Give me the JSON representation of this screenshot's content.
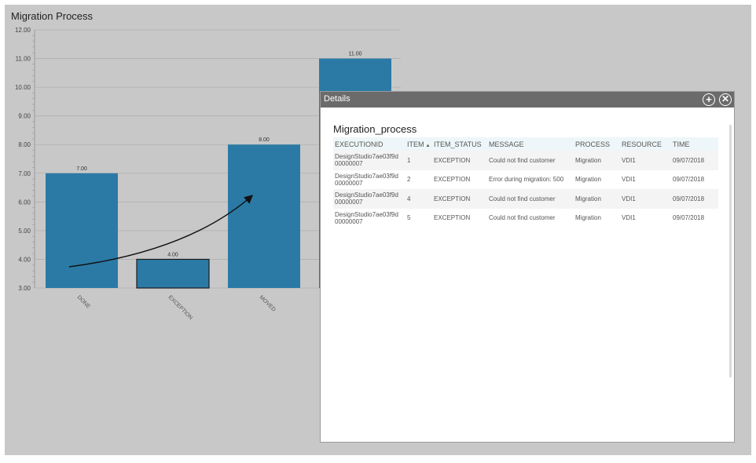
{
  "chart_title": "Migration Process",
  "chart_data": {
    "type": "bar",
    "categories": [
      "DONE",
      "EXCEPTION",
      "MOVED"
    ],
    "values": [
      7.0,
      4.0,
      8.0
    ],
    "value_labels": [
      "7.00",
      "4.00",
      "8.00"
    ],
    "partial_bar": {
      "value": 11.0,
      "label": "11.00"
    },
    "ylim": [
      3,
      12
    ],
    "yticks": [
      "3.00",
      "4.00",
      "5.00",
      "6.00",
      "7.00",
      "8.00",
      "9.00",
      "10.00",
      "11.00",
      "12.00"
    ],
    "bar_color": "#2b7aa6",
    "highlighted_category": "EXCEPTION",
    "grid": true
  },
  "details": {
    "title": "Details",
    "add_icon": "plus-circle-icon",
    "close_icon": "x-circle-icon",
    "process_name": "Migration_process",
    "columns": [
      "EXECUTIONID",
      "ITEM",
      "ITEM_STATUS",
      "MESSAGE",
      "PROCESS",
      "RESOURCE",
      "TIME"
    ],
    "sorted_column": "ITEM",
    "rows": [
      {
        "exec_1": "DesignStudio7ae03f9d",
        "exec_2": "00000007",
        "item": "1",
        "status": "EXCEPTION",
        "message": "Could not find customer",
        "process": "Migration",
        "resource": "VDI1",
        "time": "09/07/2018"
      },
      {
        "exec_1": "DesignStudio7ae03f9d",
        "exec_2": "00000007",
        "item": "2",
        "status": "EXCEPTION",
        "message": "Error during migration: 500",
        "process": "Migration",
        "resource": "VDI1",
        "time": "09/07/2018"
      },
      {
        "exec_1": "DesignStudio7ae03f9d",
        "exec_2": "00000007",
        "item": "4",
        "status": "EXCEPTION",
        "message": "Could not find customer",
        "process": "Migration",
        "resource": "VDI1",
        "time": "09/07/2018"
      },
      {
        "exec_1": "DesignStudio7ae03f9d",
        "exec_2": "00000007",
        "item": "5",
        "status": "EXCEPTION",
        "message": "Could not find customer",
        "process": "Migration",
        "resource": "VDI1",
        "time": "09/07/2018"
      }
    ]
  }
}
